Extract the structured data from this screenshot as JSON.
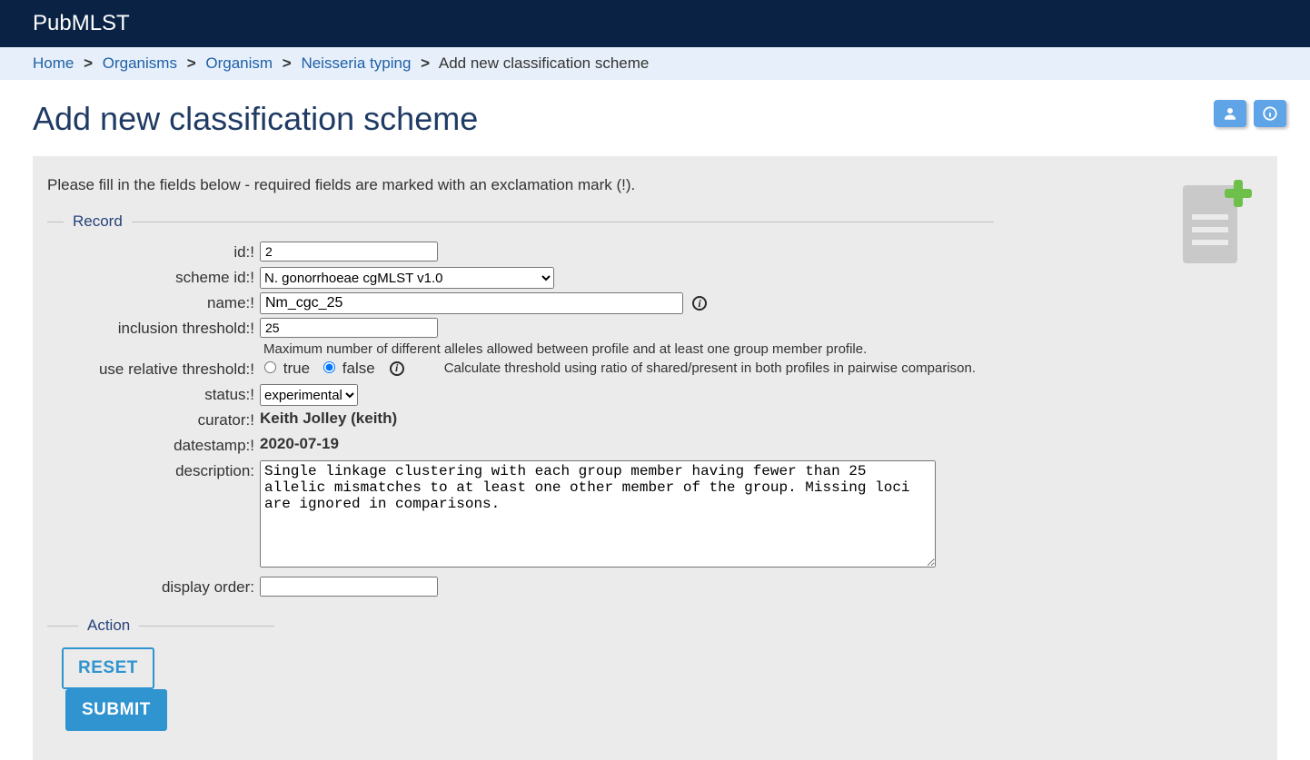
{
  "brand": "PubMLST",
  "breadcrumbs": {
    "home": "Home",
    "organisms": "Organisms",
    "organism": "Organism",
    "typing": "Neisseria typing",
    "current": "Add new classification scheme"
  },
  "page_title": "Add new classification scheme",
  "intro": "Please fill in the fields below - required fields are marked with an exclamation mark (!).",
  "record": {
    "legend": "Record",
    "labels": {
      "id": "id:!",
      "scheme_id": "scheme id:!",
      "name": "name:!",
      "inclusion_threshold": "inclusion threshold:!",
      "use_relative_threshold": "use relative threshold:!",
      "status": "status:!",
      "curator": "curator:!",
      "datestamp": "datestamp:!",
      "description": "description:",
      "display_order": "display order:"
    },
    "values": {
      "id": "2",
      "scheme_id_selected": "N. gonorrhoeae cgMLST v1.0",
      "name": "Nm_cgc_25",
      "inclusion_threshold": "25",
      "use_relative_threshold": "false",
      "status_selected": "experimental",
      "curator": "Keith Jolley (keith)",
      "datestamp": "2020-07-19",
      "description": "Single linkage clustering with each group member having fewer than 25 allelic mismatches to at least one other member of the group. Missing loci are ignored in comparisons.",
      "display_order": ""
    },
    "hints": {
      "inclusion_threshold": "Maximum number of different alleles allowed between profile and at least one group member profile.",
      "use_relative_threshold": "Calculate threshold using ratio of shared/present in both profiles in pairwise comparison."
    },
    "radio": {
      "true_label": "true",
      "false_label": "false"
    }
  },
  "action": {
    "legend": "Action",
    "reset": "RESET",
    "submit": "SUBMIT"
  }
}
